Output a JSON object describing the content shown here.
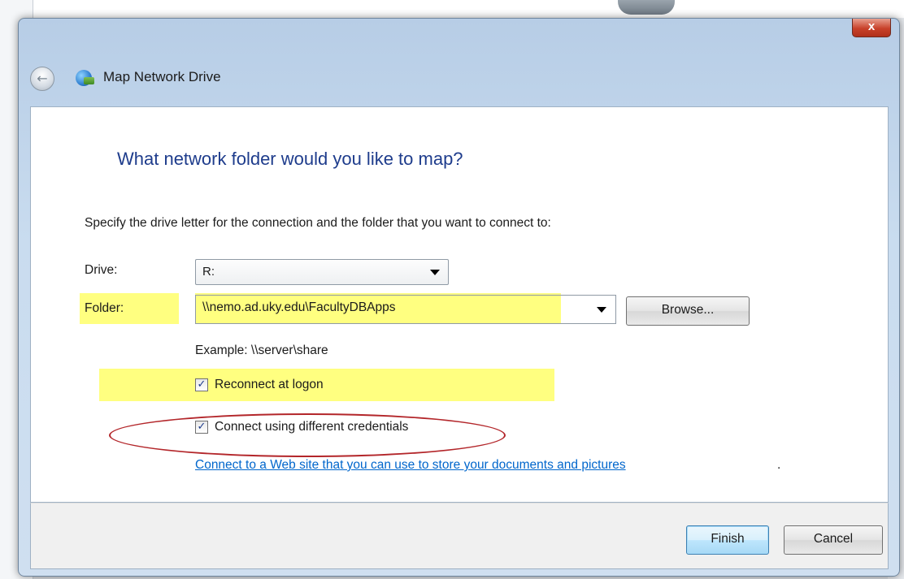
{
  "window": {
    "title": "Map Network Drive",
    "close_label": "x"
  },
  "heading": "What network folder would you like to map?",
  "instruction": "Specify the drive letter for the connection and the folder that you want to connect to:",
  "drive": {
    "label": "Drive:",
    "value": "R:"
  },
  "folder": {
    "label": "Folder:",
    "value": "\\\\nemo.ad.uky.edu\\FacultyDBApps",
    "browse_label": "Browse..."
  },
  "example": "Example: \\\\server\\share",
  "reconnect": {
    "label": "Reconnect at logon",
    "checked": true
  },
  "credentials": {
    "label": "Connect using different credentials",
    "checked": true
  },
  "web_link": {
    "text": "Connect to a Web site that you can use to store your documents and pictures",
    "suffix": "."
  },
  "buttons": {
    "finish": "Finish",
    "cancel": "Cancel"
  },
  "colors": {
    "highlight": "#ffff6a",
    "annotation_ellipse": "#b3262a",
    "heading": "#1e3c8c",
    "link": "#0066cc"
  },
  "icons": {
    "back": "back-arrow-icon",
    "app": "network-drive-icon",
    "dropdown": "chevron-down-icon",
    "close": "close-icon"
  }
}
